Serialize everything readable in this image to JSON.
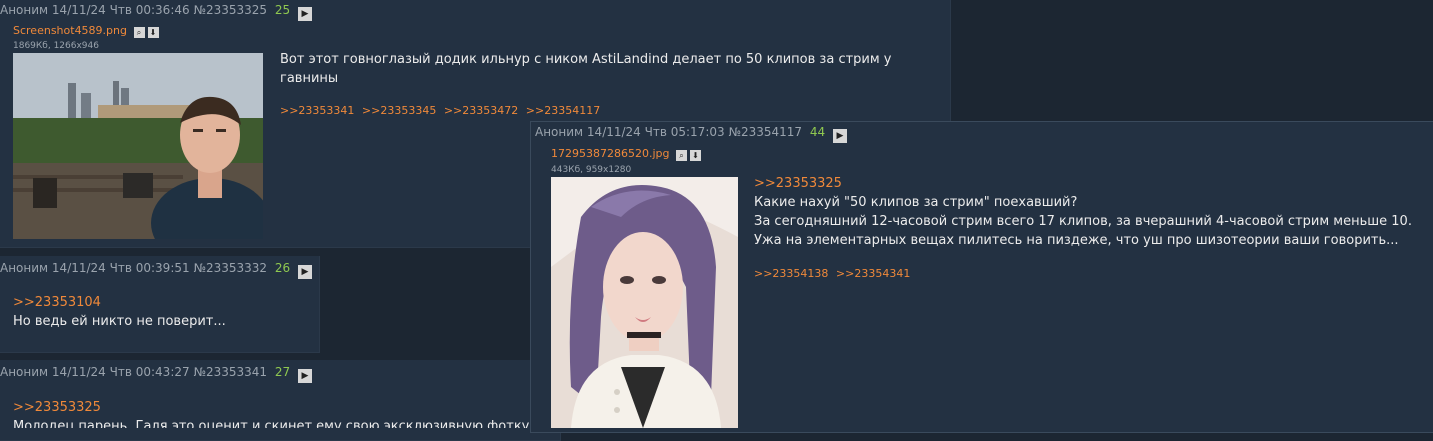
{
  "posts": [
    {
      "author": "Аноним",
      "date": "14/11/24 Чтв 00:36:46",
      "number": "№23353325",
      "count": "25",
      "file_name": "Screenshot4589.png",
      "file_meta": "1869Кб, 1266x946",
      "message": "Вот этот говноглазый додик ильнур с ником AstiLandind делает по 50 клипов за стрим у гавнины",
      "replies": [
        ">>23353341",
        ">>23353345",
        ">>23353472",
        ">>23354117"
      ]
    },
    {
      "author": "Аноним",
      "date": "14/11/24 Чтв 00:39:51",
      "number": "№23353332",
      "count": "26",
      "quote": ">>23353104",
      "message": "Но ведь ей никто не поверит..."
    },
    {
      "author": "Аноним",
      "date": "14/11/24 Чтв 00:43:27",
      "number": "№23353341",
      "count": "27",
      "quote": ">>23353325",
      "message": "Молодец парень. Галя это оценит и скинет ему свою эксклюзивную фотку"
    },
    {
      "author": "Аноним",
      "date": "14/11/24 Чтв 05:17:03",
      "number": "№23354117",
      "count": "44",
      "file_name": "17295387286520.jpg",
      "file_meta": "443Кб, 959x1280",
      "quote": ">>23353325",
      "lines": [
        "Какие нахуй \"50 клипов за стрим\" поехавший?",
        "За сегодняшний 12-часовой стрим всего 17 клипов, за вчерашний 4-часовой стрим меньше 10.",
        "Ужа на элементарных вещах пилитесь на пиздеже, что уш про шизотеории ваши говорить..."
      ],
      "replies": [
        ">>23354138",
        ">>23354341"
      ]
    }
  ],
  "icons": {
    "play": "play-icon",
    "search": "search-icon",
    "download": "download-icon"
  },
  "colors": {
    "background": "#1c2632",
    "post_bg": "#233142",
    "link": "#f0893a",
    "count": "#8fc850"
  }
}
